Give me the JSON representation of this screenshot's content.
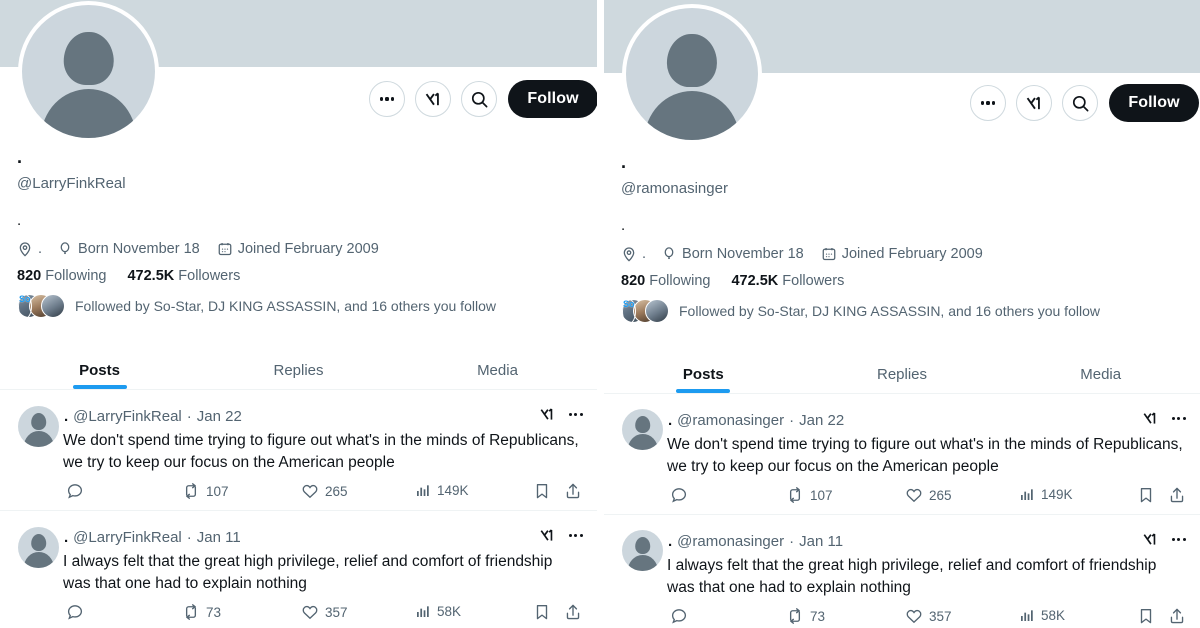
{
  "app": "X (Twitter) profile comparison",
  "colors": {
    "banner": "#cfd9de",
    "accent_blue": "#1d9bf0",
    "text_primary": "#0f1419",
    "text_secondary": "#536471",
    "follow_button_bg": "#0f1419",
    "divider": "#eff3f4"
  },
  "panels": [
    {
      "id": "left",
      "header": {
        "more_label": "More",
        "grok_label": "Grok",
        "search_label": "Search",
        "follow_label": "Follow"
      },
      "profile": {
        "display_name": ".",
        "handle": "@LarryFinkReal",
        "bio": ".",
        "location": ".",
        "birthday": "Born November 18",
        "joined": "Joined February 2009",
        "following_count": "820",
        "following_label": "Following",
        "followers_count": "472.5K",
        "followers_label": "Followers",
        "followed_by": "Followed by So-Star, DJ KING ASSASSIN, and 16 others you follow",
        "followed_by_badge": "So"
      },
      "tabs": [
        {
          "label": "Posts",
          "active": true
        },
        {
          "label": "Replies",
          "active": false
        },
        {
          "label": "Media",
          "active": false
        }
      ],
      "tweets": [
        {
          "name": ".",
          "handle": "@LarryFinkReal",
          "separator": "·",
          "date": "Jan 22",
          "text": "We don't spend time trying to figure out what's in the minds of Republicans, we try to keep our focus on the American people",
          "reply_count": "",
          "retweet_count": "107",
          "like_count": "265",
          "view_count": "149K"
        },
        {
          "name": ".",
          "handle": "@LarryFinkReal",
          "separator": "·",
          "date": "Jan 11",
          "text": "I always felt that the great high privilege, relief and comfort of friendship was that one had to explain nothing",
          "reply_count": "",
          "retweet_count": "73",
          "like_count": "357",
          "view_count": "58K"
        }
      ]
    },
    {
      "id": "right",
      "header": {
        "more_label": "More",
        "grok_label": "Grok",
        "search_label": "Search",
        "follow_label": "Follow"
      },
      "profile": {
        "display_name": ".",
        "handle": "@ramonasinger",
        "bio": ".",
        "location": ".",
        "birthday": "Born November 18",
        "joined": "Joined February 2009",
        "following_count": "820",
        "following_label": "Following",
        "followers_count": "472.5K",
        "followers_label": "Followers",
        "followed_by": "Followed by So-Star, DJ KING ASSASSIN, and 16 others you follow",
        "followed_by_badge": "So"
      },
      "tabs": [
        {
          "label": "Posts",
          "active": true
        },
        {
          "label": "Replies",
          "active": false
        },
        {
          "label": "Media",
          "active": false
        }
      ],
      "tweets": [
        {
          "name": ".",
          "handle": "@ramonasinger",
          "separator": "·",
          "date": "Jan 22",
          "text": "We don't spend time trying to figure out what's in the minds of Republicans, we try to keep our focus on the American people",
          "reply_count": "",
          "retweet_count": "107",
          "like_count": "265",
          "view_count": "149K"
        },
        {
          "name": ".",
          "handle": "@ramonasinger",
          "separator": "·",
          "date": "Jan 11",
          "text": "I always felt that the great high privilege, relief and comfort of friendship was that one had to explain nothing",
          "reply_count": "",
          "retweet_count": "73",
          "like_count": "357",
          "view_count": "58K"
        }
      ]
    }
  ]
}
